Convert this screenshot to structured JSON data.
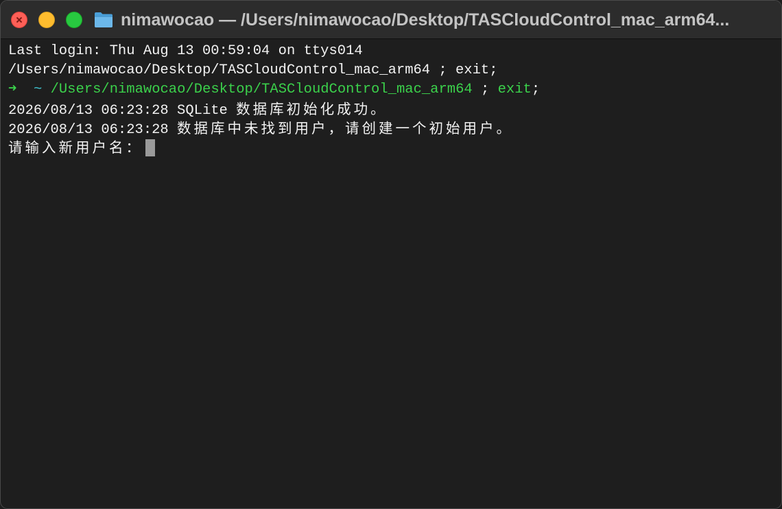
{
  "window": {
    "title": "nimawocao — /Users/nimawocao/Desktop/TASCloudControl_mac_arm64...",
    "folder_icon": "folder-icon",
    "controls": {
      "close_icon": "close-icon",
      "minimize_icon": "minimize-icon",
      "zoom_icon": "zoom-icon"
    }
  },
  "colors": {
    "prompt_arrow": "#3bd14b",
    "prompt_tilde": "#3fc3d0",
    "path": "#3bd14b",
    "text": "#f2f2f2"
  },
  "terminal": {
    "line1": "Last login: Thu Aug 13 00:59:04 on ttys014",
    "line2": "/Users/nimawocao/Desktop/TASCloudControl_mac_arm64 ; exit;",
    "line3": {
      "arrow": "➜",
      "tilde": "~",
      "path": "/Users/nimawocao/Desktop/TASCloudControl_mac_arm64",
      "separator": " ; ",
      "exit": "exit",
      "end": ";"
    },
    "line4": {
      "timestamp": "2026/08/13 06:23:28 SQLite ",
      "message": "数据库初始化成功。"
    },
    "line5": {
      "timestamp": "2026/08/13 06:23:28 ",
      "message": "数据库中未找到用户，请创建一个初始用户。"
    },
    "line6": {
      "prompt": "请输入新用户名："
    }
  }
}
